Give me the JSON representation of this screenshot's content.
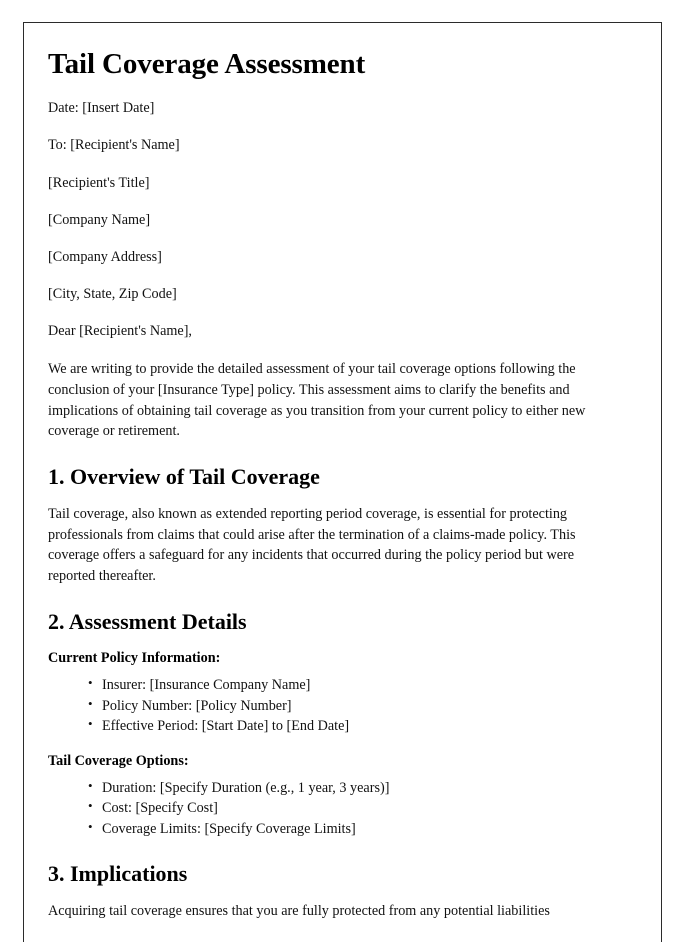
{
  "document": {
    "title": "Tail Coverage Assessment",
    "letter_head": [
      {
        "name": "date-line",
        "text": "Date: [Insert Date]"
      },
      {
        "name": "recipient-name-line",
        "text": "To: [Recipient's Name]"
      },
      {
        "name": "recipient-title-line",
        "text": "[Recipient's Title]"
      },
      {
        "name": "company-name-line",
        "text": "[Company Name]"
      },
      {
        "name": "company-address-line",
        "text": "[Company Address]"
      },
      {
        "name": "city-state-zip-line",
        "text": "[City, State, Zip Code]"
      },
      {
        "name": "salutation-line",
        "text": "Dear [Recipient's Name],"
      }
    ],
    "intro_paragraph": "We are writing to provide the detailed assessment of your tail coverage options following the conclusion of your [Insurance Type] policy. This assessment aims to clarify the benefits and implications of obtaining tail coverage as you transition from your current policy to either new coverage or retirement.",
    "sections": [
      {
        "heading": "1. Overview of Tail Coverage",
        "paragraph": "Tail coverage, also known as extended reporting period coverage, is essential for protecting professionals from claims that could arise after the termination of a claims-made policy. This coverage offers a safeguard for any incidents that occurred during the policy period but were reported thereafter."
      },
      {
        "heading": "2. Assessment Details",
        "subsections": [
          {
            "label": "Current Policy Information:",
            "items": [
              "Insurer: [Insurance Company Name]",
              "Policy Number: [Policy Number]",
              "Effective Period: [Start Date] to [End Date]"
            ]
          },
          {
            "label": "Tail Coverage Options:",
            "items": [
              "Duration: [Specify Duration (e.g., 1 year, 3 years)]",
              "Cost: [Specify Cost]",
              "Coverage Limits: [Specify Coverage Limits]"
            ]
          }
        ]
      },
      {
        "heading": "3. Implications",
        "paragraph": "Acquiring tail coverage ensures that you are fully protected from any potential liabilities"
      }
    ]
  }
}
